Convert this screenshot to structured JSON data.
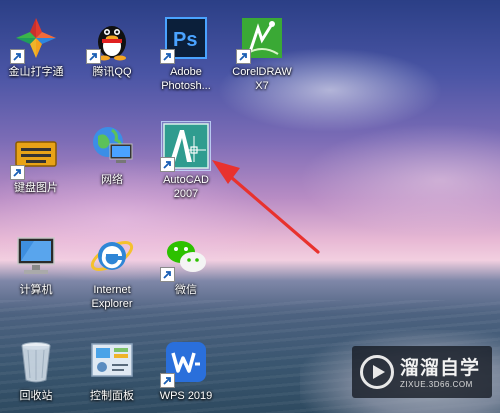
{
  "desktop": {
    "icons": [
      {
        "label": "金山打字通",
        "icon": "jinshan-typing-icon",
        "shortcut": true
      },
      {
        "label": "腾讯QQ",
        "icon": "qq-penguin-icon",
        "shortcut": true
      },
      {
        "label": "Adobe Photosh...",
        "icon": "photoshop-icon",
        "shortcut": true
      },
      {
        "label": "CorelDRAW X7",
        "icon": "coreldraw-icon",
        "shortcut": true
      },
      {
        "label": "键盘图片",
        "icon": "keyboard-image-icon",
        "shortcut": true
      },
      {
        "label": "网络",
        "icon": "network-globe-icon",
        "shortcut": false
      },
      {
        "label": "AutoCAD 2007",
        "icon": "autocad-icon",
        "shortcut": true,
        "selected": true
      },
      {
        "label": "计算机",
        "icon": "computer-icon",
        "shortcut": false
      },
      {
        "label": "Internet Explorer",
        "icon": "internet-explorer-icon",
        "shortcut": false
      },
      {
        "label": "微信",
        "icon": "wechat-icon",
        "shortcut": true
      },
      {
        "label": "回收站",
        "icon": "recycle-bin-icon",
        "shortcut": false
      },
      {
        "label": "控制面板",
        "icon": "control-panel-icon",
        "shortcut": false
      },
      {
        "label": "WPS 2019",
        "icon": "wps-icon",
        "shortcut": true
      }
    ]
  },
  "annotation": {
    "type": "red-arrow",
    "points_to": "AutoCAD 2007",
    "color": "#e8322e"
  },
  "watermark": {
    "title": "溜溜自学",
    "url": "ZIXUE.3D66.COM"
  }
}
